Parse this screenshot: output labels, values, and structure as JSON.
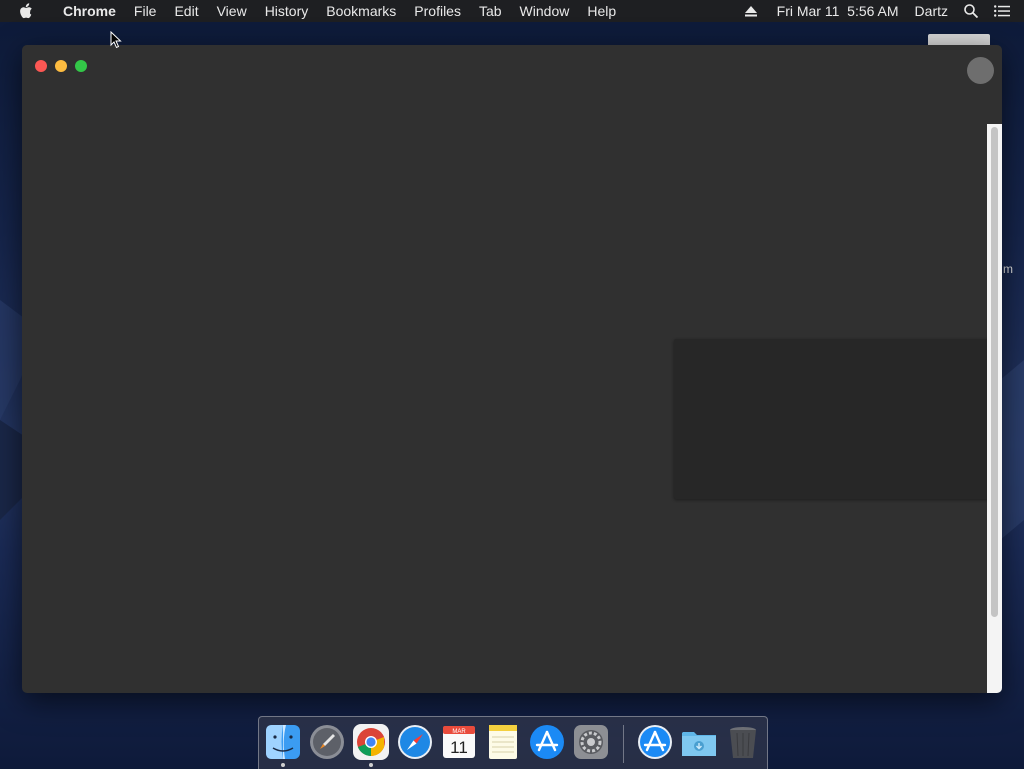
{
  "menubar": {
    "app_name": "Chrome",
    "items": [
      "File",
      "Edit",
      "View",
      "History",
      "Bookmarks",
      "Profiles",
      "Tab",
      "Window",
      "Help"
    ],
    "clock": "Fri Mar 11  5:56 AM",
    "user": "Dartz"
  },
  "icons": {
    "apple": "apple-logo-icon",
    "eject": "eject-icon",
    "spotlight": "search-icon",
    "notifications": "list-icon"
  },
  "desktop": {
    "partial_label": "m"
  },
  "dock": {
    "apps": [
      {
        "name": "Finder",
        "icon": "finder-icon",
        "running": true
      },
      {
        "name": "Launchpad",
        "icon": "launchpad-icon",
        "running": false
      },
      {
        "name": "Google Chrome",
        "icon": "chrome-icon",
        "running": true
      },
      {
        "name": "Safari",
        "icon": "safari-icon",
        "running": false
      },
      {
        "name": "Calendar",
        "icon": "calendar-icon",
        "running": false,
        "month": "MAR",
        "day": "11"
      },
      {
        "name": "Notes",
        "icon": "notes-icon",
        "running": false
      },
      {
        "name": "App Store",
        "icon": "app-store-icon",
        "running": false
      },
      {
        "name": "System Preferences",
        "icon": "system-preferences-icon",
        "running": false
      },
      {
        "name": "App Store Download",
        "icon": "app-store-icon",
        "running": false
      },
      {
        "name": "Downloads",
        "icon": "downloads-folder-icon",
        "running": false
      },
      {
        "name": "Trash",
        "icon": "trash-icon",
        "running": false
      }
    ]
  },
  "colors": {
    "window_bg": "#303030",
    "panel_bg": "#272727",
    "menubar_bg": "#1e1f22",
    "close": "#fc5753",
    "minimize": "#fdbc40",
    "maximize": "#33c748"
  }
}
